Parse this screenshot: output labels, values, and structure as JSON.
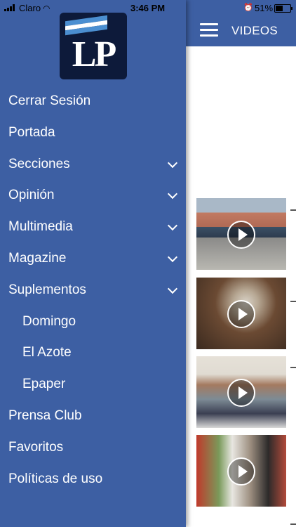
{
  "status_bar": {
    "carrier": "Claro",
    "time": "3:46 PM",
    "battery_percent": "51%",
    "battery_level": 0.51
  },
  "header": {
    "section_title": "VIDEOS",
    "menu_icon": "hamburger-icon"
  },
  "logo": {
    "text": "LP"
  },
  "menu": {
    "items": [
      {
        "label": "Cerrar Sesión",
        "expandable": false,
        "sub": false
      },
      {
        "label": "Portada",
        "expandable": false,
        "sub": false
      },
      {
        "label": "Secciones",
        "expandable": true,
        "sub": false
      },
      {
        "label": "Opinión",
        "expandable": true,
        "sub": false
      },
      {
        "label": "Multimedia",
        "expandable": true,
        "sub": false
      },
      {
        "label": "Magazine",
        "expandable": true,
        "sub": false
      },
      {
        "label": "Suplementos",
        "expandable": true,
        "sub": false
      },
      {
        "label": "Domingo",
        "expandable": false,
        "sub": true
      },
      {
        "label": "El Azote",
        "expandable": false,
        "sub": true
      },
      {
        "label": "Epaper",
        "expandable": false,
        "sub": true
      },
      {
        "label": "Prensa Club",
        "expandable": false,
        "sub": false
      },
      {
        "label": "Favoritos",
        "expandable": false,
        "sub": false
      },
      {
        "label": "Políticas de uso",
        "expandable": false,
        "sub": false
      }
    ]
  },
  "videos": [
    {
      "thumbnail": "street-scene",
      "play_icon": "play-icon"
    },
    {
      "thumbnail": "man-seated",
      "play_icon": "play-icon"
    },
    {
      "thumbnail": "group-of-people",
      "play_icon": "play-icon"
    },
    {
      "thumbnail": "clergy-event",
      "play_icon": "play-icon"
    }
  ],
  "colors": {
    "drawer_bg": "#3d5fa3",
    "topbar_bg": "#3d5fa3",
    "logo_bg": "#0d1a3a",
    "text": "#ffffff"
  }
}
